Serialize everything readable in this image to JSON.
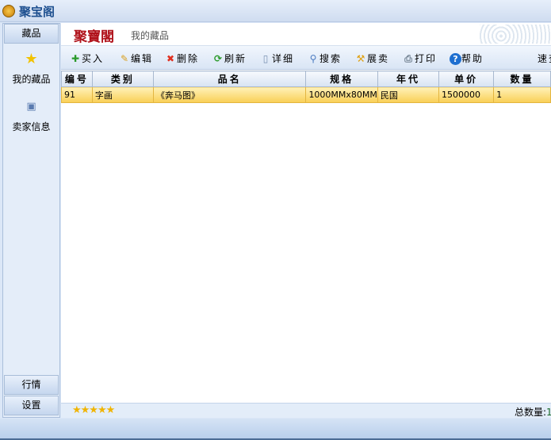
{
  "window": {
    "title": "聚宝阁"
  },
  "sidebar": {
    "top_button": "藏品",
    "items": [
      {
        "label": "我的藏品",
        "icon": "star-icon"
      },
      {
        "label": "卖家信息",
        "icon": "id-card-icon"
      }
    ],
    "bottom_buttons": [
      "行情",
      "设置"
    ]
  },
  "header": {
    "logo": "聚寶閣",
    "subtitle": "我的藏品"
  },
  "toolbar": {
    "items": [
      {
        "label": "买入",
        "icon": "plus-icon"
      },
      {
        "label": "编辑",
        "icon": "pencil-icon"
      },
      {
        "label": "删除",
        "icon": "delete-x-icon"
      },
      {
        "label": "刷新",
        "icon": "refresh-icon"
      },
      {
        "label": "详细",
        "icon": "document-icon"
      },
      {
        "label": "搜索",
        "icon": "magnifier-icon"
      },
      {
        "label": "展卖",
        "icon": "gavel-icon"
      },
      {
        "label": "打印",
        "icon": "printer-icon"
      },
      {
        "label": "帮助",
        "icon": "help-icon"
      }
    ],
    "quick_search": "速查"
  },
  "table": {
    "columns": [
      "编号",
      "类别",
      "品名",
      "规格",
      "年代",
      "单价",
      "数量"
    ],
    "rows": [
      [
        "91",
        "字画",
        "《奔马图》",
        "1000MMx80MM",
        "民国",
        "1500000",
        "1"
      ]
    ]
  },
  "status": {
    "rating": 5,
    "total_label": "总数量:",
    "total_value": "1"
  },
  "colors": {
    "accent": "#1d4f8f",
    "logo": "#b0121a",
    "row_highlight": "#f9cf55"
  }
}
